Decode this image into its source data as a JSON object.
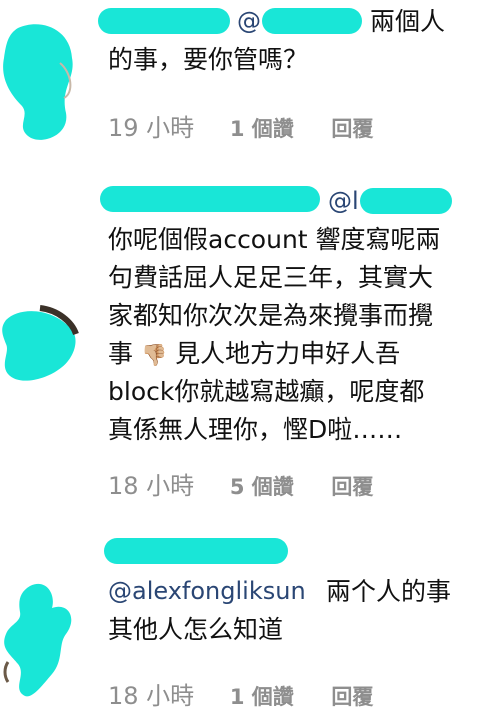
{
  "comments": [
    {
      "mention": "@",
      "lines": [
        "兩個人",
        "的事，要你管嗎？"
      ],
      "time": "19 小時",
      "likes": "1 個讚",
      "reply": "回覆"
    },
    {
      "mention": "@l",
      "lines": [
        "你呢個假account 響度寫呢兩",
        "句費話屈人足足三年，其實大",
        "家都知你次次是為來攪事而攪",
        "事",
        "block你就越寫越癲，呢度都",
        "真係無人理你，慳D啦……"
      ],
      "line4_rest": " 見人地方力申好人吾",
      "emoji": "👎🏼",
      "time": "18 小時",
      "likes": "5 個讚",
      "reply": "回覆"
    },
    {
      "mention": "@alexfongliksun",
      "lines": [
        "兩个人的事",
        "其他人怎么知道"
      ],
      "time": "18 小時",
      "likes": "1 個讚",
      "reply": "回覆"
    }
  ],
  "colors": {
    "redaction": "#19e6d7",
    "mention": "#2a4674",
    "meta": "#8e8e8e"
  },
  "icons": {
    "thumbs_down": "thumbs-down-icon"
  }
}
